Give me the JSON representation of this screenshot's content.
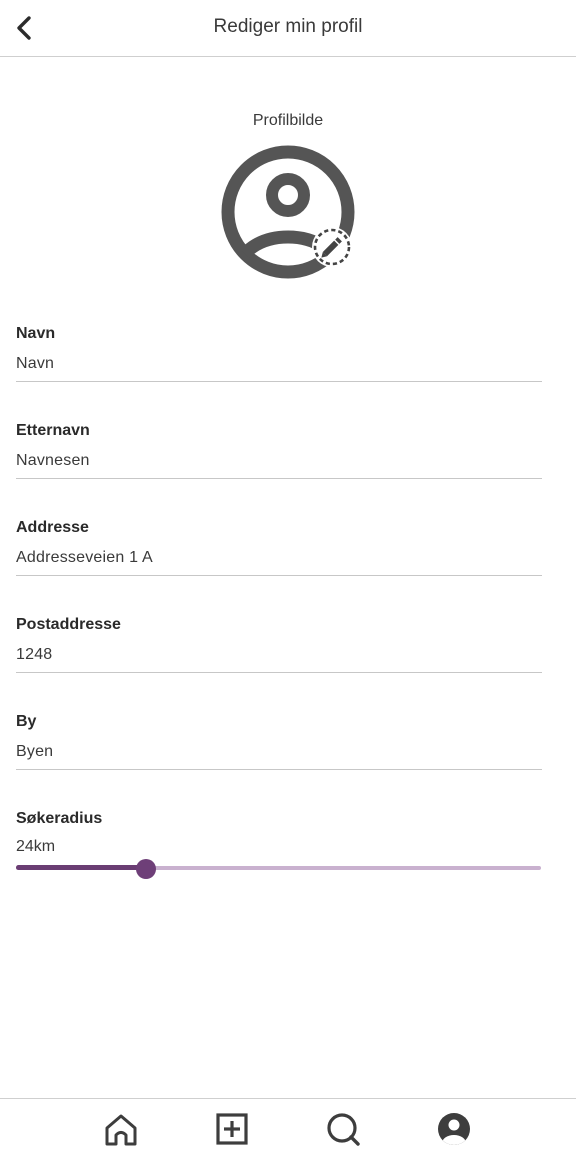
{
  "header": {
    "title": "Rediger min profil",
    "back_icon": "chevron-left-icon"
  },
  "avatar": {
    "label": "Profilbilde",
    "icon": "user-circle-icon",
    "edit_icon": "pencil-icon"
  },
  "form": {
    "fields": [
      {
        "label": "Navn",
        "value": "Navn"
      },
      {
        "label": "Etternavn",
        "value": "Navnesen"
      },
      {
        "label": "Addresse",
        "value": "Addresseveien 1 A"
      },
      {
        "label": "Postaddresse",
        "value": "1248"
      },
      {
        "label": "By",
        "value": "Byen"
      }
    ],
    "radius": {
      "label": "Søkeradius",
      "value_text": "24km",
      "fraction": 0.247
    }
  },
  "colors": {
    "accent": "#6e3f78",
    "accent_light": "#c9b1cf",
    "icon_dark": "#3d3d3d"
  },
  "bottom_nav": {
    "items": [
      {
        "icon": "home-icon"
      },
      {
        "icon": "add-square-icon"
      },
      {
        "icon": "search-icon"
      },
      {
        "icon": "profile-icon"
      }
    ]
  }
}
